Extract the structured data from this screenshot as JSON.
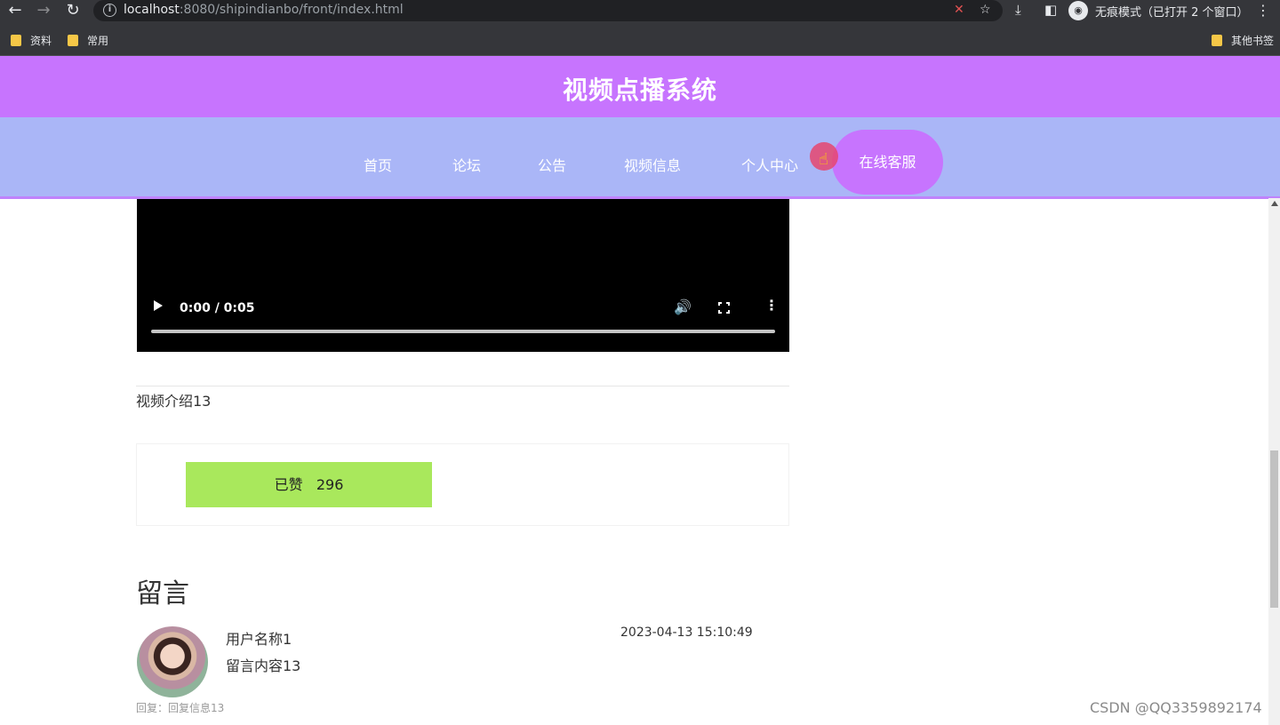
{
  "browser": {
    "url_host": "localhost",
    "url_rest": ":8080/shipindianbo/front/index.html",
    "incognito_label": "无痕模式（已打开 2 个窗口）",
    "bookmarks": [
      "资料",
      "常用"
    ],
    "other_bookmarks": "其他书签"
  },
  "site": {
    "title": "视频点播系统",
    "nav": [
      "首页",
      "论坛",
      "公告",
      "视频信息",
      "个人中心"
    ],
    "nav_active": "在线客服",
    "header_color": "#c774fe",
    "nav_color": "#aab6f7"
  },
  "video": {
    "time": "0:00 / 0:05",
    "progress": 0
  },
  "detail": {
    "intro": "视频介绍13",
    "like_label": "已赞   296",
    "like_color": "#a9e85c"
  },
  "messages": {
    "title": "留言",
    "items": [
      {
        "username": "用户名称1",
        "time": "2023-04-13 15:10:49",
        "content": "留言内容13",
        "reply": "回复：回复信息13"
      }
    ]
  },
  "watermark": "CSDN @QQ3359892174"
}
